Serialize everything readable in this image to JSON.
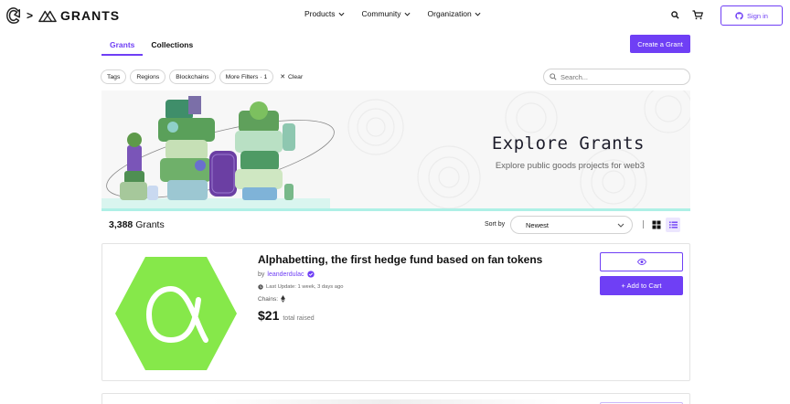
{
  "nav": {
    "brand": "GRANTS",
    "menu": [
      {
        "label": "Products"
      },
      {
        "label": "Community"
      },
      {
        "label": "Organization"
      }
    ],
    "signin_label": "Sign in"
  },
  "tabs": [
    {
      "label": "Grants",
      "active": true
    },
    {
      "label": "Collections",
      "active": false
    }
  ],
  "create_grant_label": "Create a Grant",
  "filters": {
    "chips": [
      "Tags",
      "Regions",
      "Blockchains",
      "More Filters · 1"
    ],
    "clear_label": "Clear",
    "search_placeholder": "Search..."
  },
  "banner": {
    "title": "Explore Grants",
    "subtitle": "Explore public goods projects for web3"
  },
  "results": {
    "count": "3,388",
    "count_label": "Grants",
    "sort_label": "Sort by",
    "sort_value": "Newest",
    "view_mode": "list"
  },
  "grants": [
    {
      "title": "Alphabetting, the first hedge fund based on fan tokens",
      "author_prefix": "by",
      "author": "leanderdulac",
      "verified": true,
      "last_update": "Last Update: 1 week, 3 days ago",
      "chains_label": "Chains:",
      "chain_icon": "ethereum-icon",
      "amount": "$21",
      "amount_label": "total raised",
      "add_to_cart_label": "+ Add to Cart",
      "logo_color": "#86e84a"
    }
  ],
  "colors": {
    "accent": "#6f3ff5",
    "banner_line": "#aef0e6"
  }
}
